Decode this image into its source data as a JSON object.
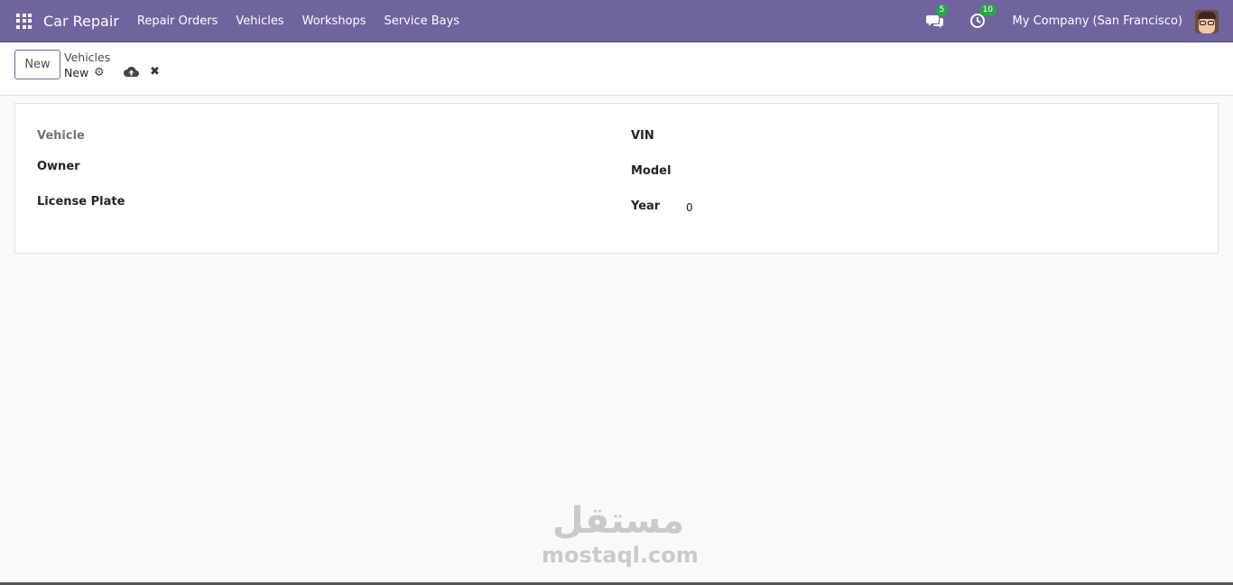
{
  "navbar": {
    "app_title": "Car Repair",
    "menu": [
      {
        "label": "Repair Orders"
      },
      {
        "label": "Vehicles"
      },
      {
        "label": "Workshops"
      },
      {
        "label": "Service Bays"
      }
    ],
    "messages_count": "5",
    "activities_count": "10",
    "company": "My Company (San Francisco)",
    "brand_color": "#71639e",
    "badge_color": "#28a745"
  },
  "control_panel": {
    "new_button_label": "New",
    "breadcrumb_parent": "Vehicles",
    "record_name": "New"
  },
  "form": {
    "left": {
      "vehicle_label": "Vehicle",
      "owner_label": "Owner",
      "license_plate_label": "License Plate"
    },
    "right": {
      "vin_label": "VIN",
      "model_label": "Model",
      "year_label": "Year",
      "year_value": "0"
    }
  },
  "watermark": {
    "arabic": "مستقل",
    "latin": "mostaql.com"
  }
}
